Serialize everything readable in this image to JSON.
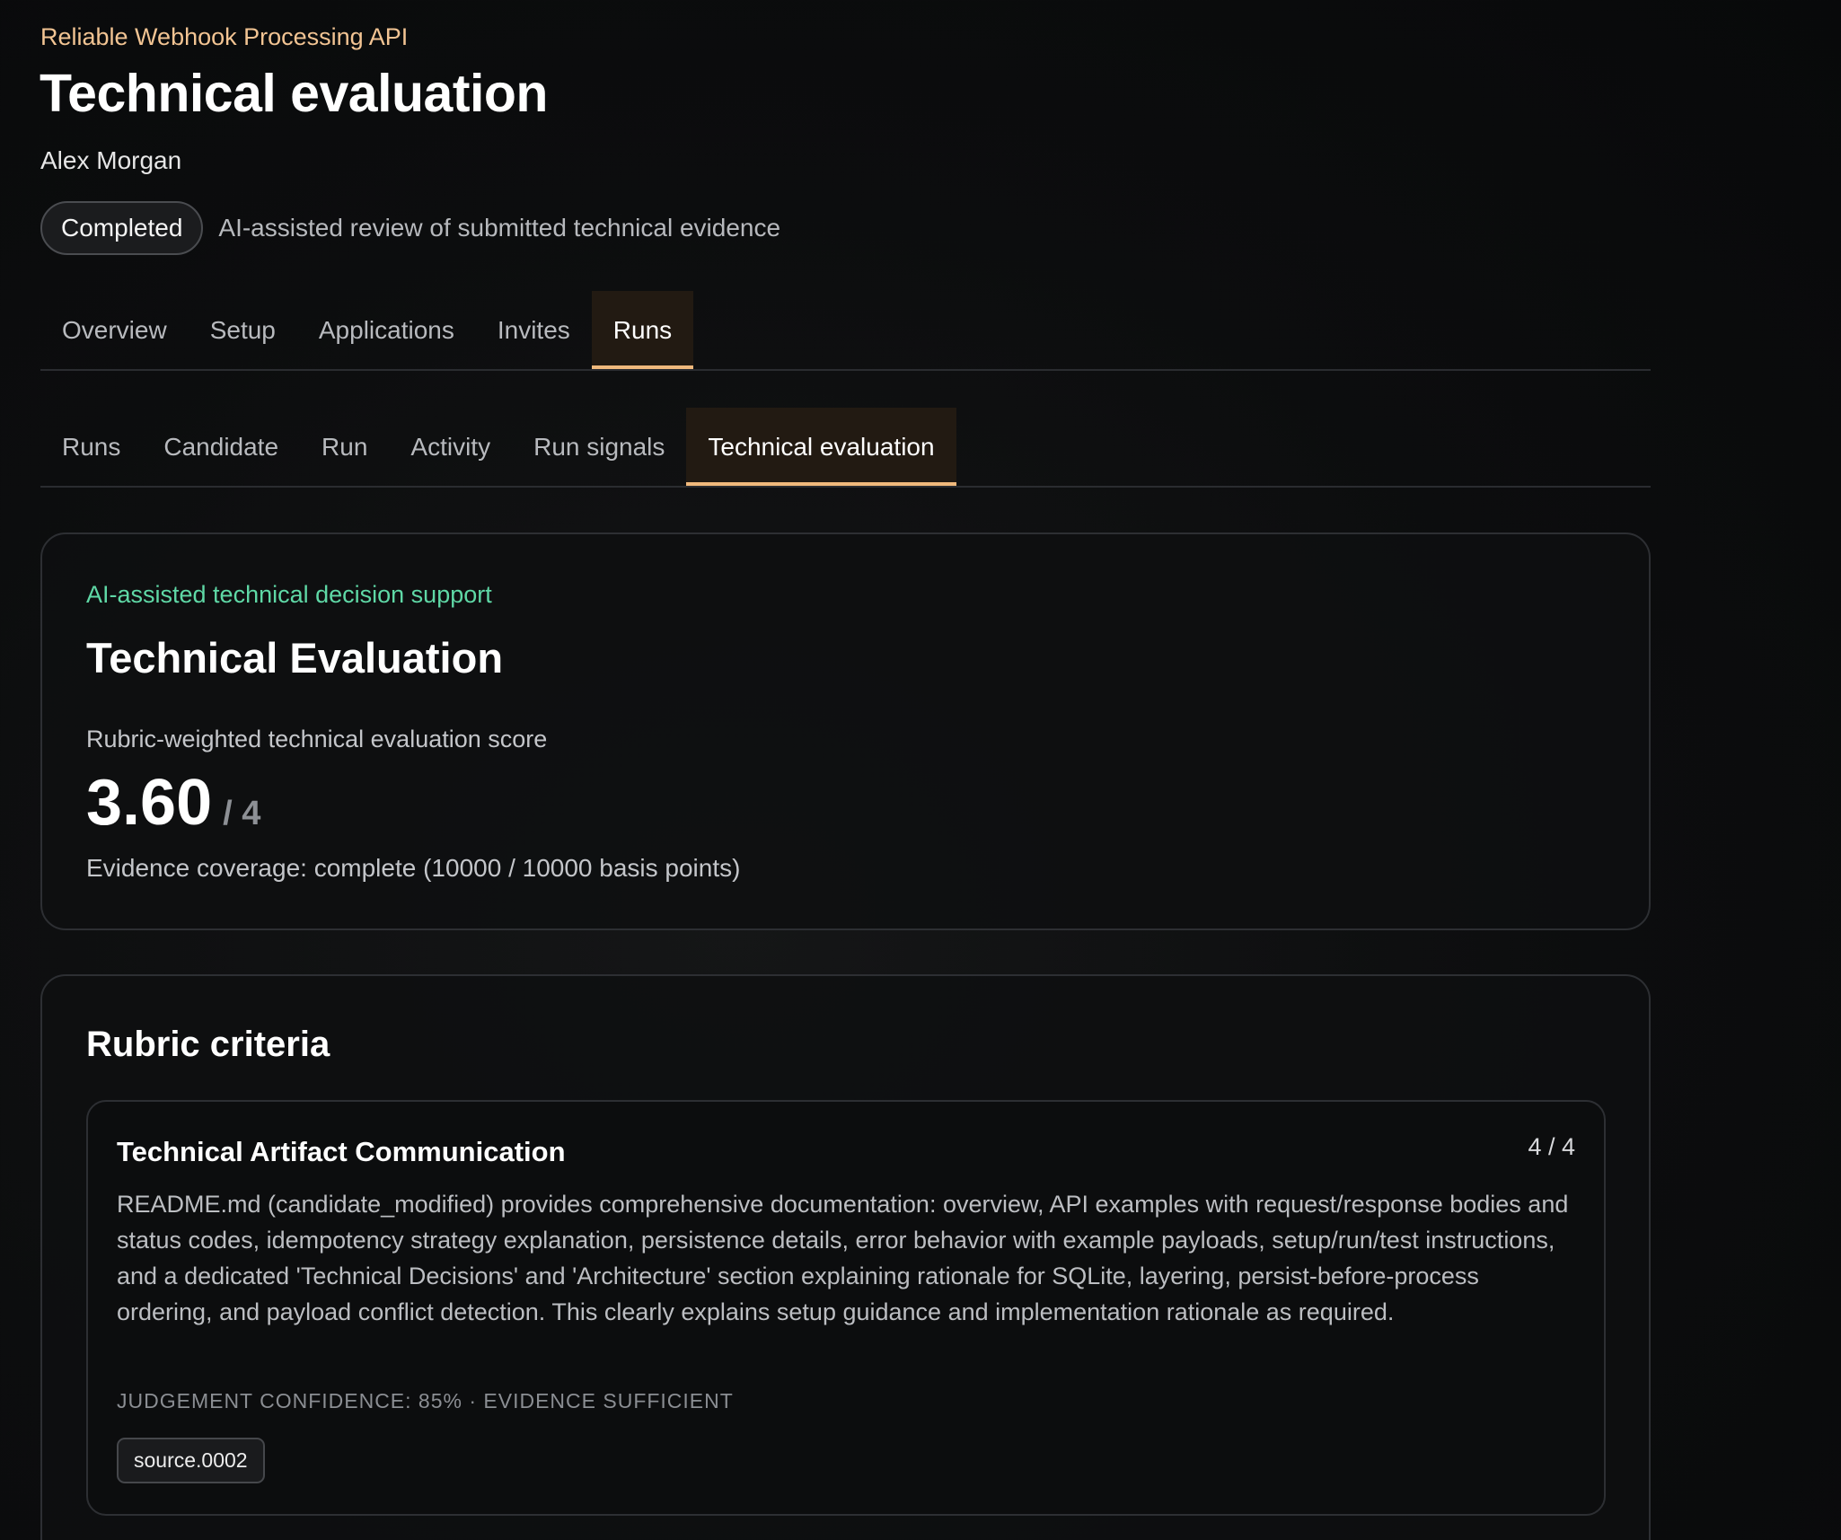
{
  "header": {
    "project": "Reliable Webhook Processing API",
    "title": "Technical evaluation",
    "owner": "Alex Morgan",
    "status": "Completed",
    "status_description": "AI-assisted review of submitted technical evidence"
  },
  "primary_tabs": [
    {
      "label": "Overview"
    },
    {
      "label": "Setup"
    },
    {
      "label": "Applications"
    },
    {
      "label": "Invites"
    },
    {
      "label": "Runs",
      "active": true
    }
  ],
  "secondary_tabs": [
    {
      "label": "Runs"
    },
    {
      "label": "Candidate"
    },
    {
      "label": "Run"
    },
    {
      "label": "Activity"
    },
    {
      "label": "Run signals"
    },
    {
      "label": "Technical evaluation",
      "active": true
    }
  ],
  "evaluation": {
    "eyebrow": "AI-assisted technical decision support",
    "title": "Technical Evaluation",
    "score_label": "Rubric-weighted technical evaluation score",
    "score": "3.60",
    "score_max": "/ 4",
    "coverage": "Evidence coverage: complete (10000 / 10000 basis points)"
  },
  "rubric": {
    "title": "Rubric criteria",
    "criteria": [
      {
        "name": "Technical Artifact Communication",
        "score": "4 / 4",
        "rationale": "README.md (candidate_modified) provides comprehensive documentation: overview, API examples with request/response bodies and status codes, idempotency strategy explanation, persistence details, error behavior with example payloads, setup/run/test instructions, and a dedicated 'Technical Decisions' and 'Architecture' section explaining rationale for SQLite, layering, persist-before-process ordering, and payload conflict detection. This clearly explains setup guidance and implementation rationale as required.",
        "meta": "JUDGEMENT CONFIDENCE: 85% · EVIDENCE SUFFICIENT",
        "source": "source.0002"
      }
    ]
  },
  "colors": {
    "accent": "#f0b97c",
    "eyebrow": "#f2c493",
    "success": "#5fd8a6",
    "background": "#0c0d0e"
  }
}
